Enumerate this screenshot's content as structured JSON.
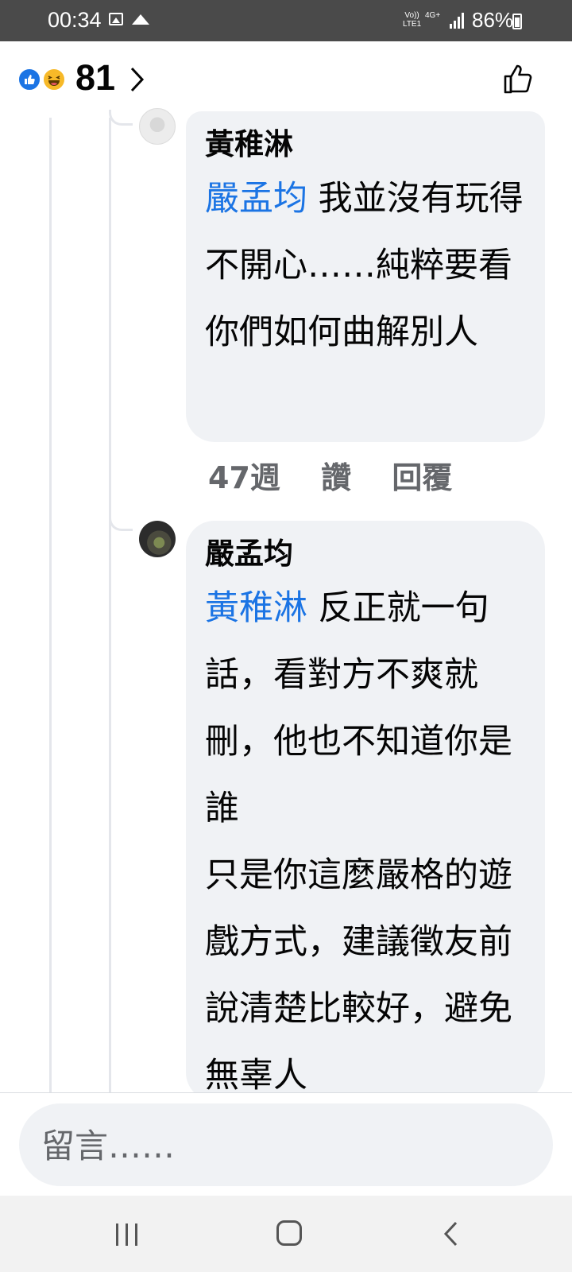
{
  "status_bar": {
    "time": "00:34",
    "volte_top": "Vo))",
    "volte_bottom": "LTE1",
    "network": "4G+",
    "battery": "86%"
  },
  "header": {
    "reaction_count": "81",
    "reactions": [
      "like-icon",
      "haha-icon"
    ]
  },
  "comments": [
    {
      "author": "黃稚淋",
      "mention": "嚴孟均",
      "text": " 我並沒有玩得不開心……純粹要看你們如何曲解別人",
      "time": "47週",
      "like_label": "讚",
      "reply_label": "回覆"
    },
    {
      "author": "嚴孟均",
      "mention": "黃稚淋",
      "text_line1": " 反正就一句話，看對方不爽就刪，他也不知道你是誰",
      "text_line2": "只是你這麼嚴格的遊戲方式，建議徵友前說清楚比較好，避免無辜人"
    }
  ],
  "composer": {
    "placeholder": "留言……"
  },
  "colors": {
    "accent": "#1b74e4",
    "bubble": "#f0f2f5",
    "meta": "#65676b",
    "status_bar": "#4a4a4a"
  }
}
